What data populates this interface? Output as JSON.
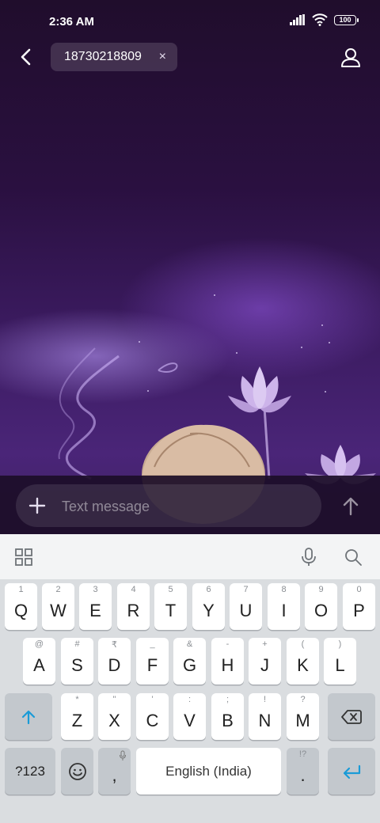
{
  "status_bar": {
    "time": "2:36 AM",
    "battery": "100"
  },
  "header": {
    "recipient": "18730218809",
    "remove_symbol": "×"
  },
  "composer": {
    "placeholder": "Text message"
  },
  "keyboard": {
    "row1": [
      {
        "hint": "1",
        "key": "Q"
      },
      {
        "hint": "2",
        "key": "W"
      },
      {
        "hint": "3",
        "key": "E"
      },
      {
        "hint": "4",
        "key": "R"
      },
      {
        "hint": "5",
        "key": "T"
      },
      {
        "hint": "6",
        "key": "Y"
      },
      {
        "hint": "7",
        "key": "U"
      },
      {
        "hint": "8",
        "key": "I"
      },
      {
        "hint": "9",
        "key": "O"
      },
      {
        "hint": "0",
        "key": "P"
      }
    ],
    "row2": [
      {
        "hint": "@",
        "key": "A"
      },
      {
        "hint": "#",
        "key": "S"
      },
      {
        "hint": "₹",
        "key": "D"
      },
      {
        "hint": "_",
        "key": "F"
      },
      {
        "hint": "&",
        "key": "G"
      },
      {
        "hint": "-",
        "key": "H"
      },
      {
        "hint": "+",
        "key": "J"
      },
      {
        "hint": "(",
        "key": "K"
      },
      {
        "hint": ")",
        "key": "L"
      }
    ],
    "row3": [
      {
        "hint": "*",
        "key": "Z"
      },
      {
        "hint": "\"",
        "key": "X"
      },
      {
        "hint": "'",
        "key": "C"
      },
      {
        "hint": ":",
        "key": "V"
      },
      {
        "hint": ";",
        "key": "B"
      },
      {
        "hint": "!",
        "key": "N"
      },
      {
        "hint": "?",
        "key": "M"
      }
    ],
    "symbols_label": "?123",
    "comma": ",",
    "space_label": "English (India)",
    "period": ".",
    "period_hint": "!?"
  },
  "colors": {
    "accent": "#1a9bd7",
    "wallpaper_top": "#200d2c",
    "wallpaper_bottom": "#4a2578"
  }
}
